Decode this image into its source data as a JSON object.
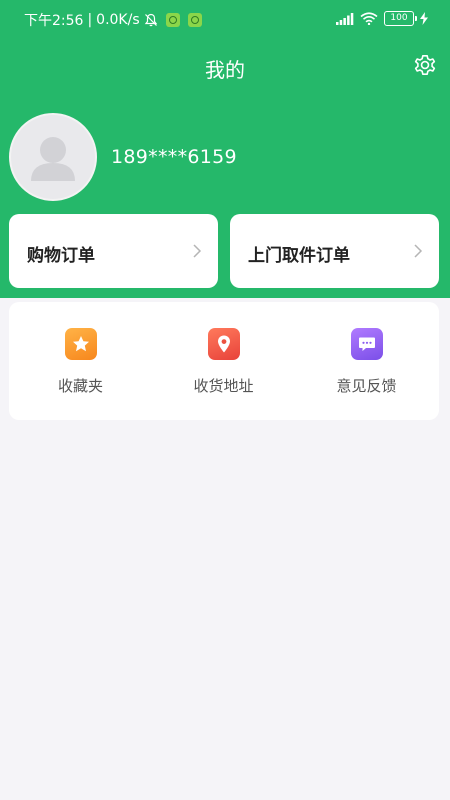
{
  "status_bar": {
    "time": "下午2:56",
    "network_speed": "0.0K/s",
    "battery": "100"
  },
  "header": {
    "title": "我的"
  },
  "profile": {
    "username": "189****6159"
  },
  "orders": [
    {
      "label": "购物订单"
    },
    {
      "label": "上门取件订单"
    }
  ],
  "menu": [
    {
      "label": "收藏夹",
      "icon": "star-icon",
      "color": "#f7941d"
    },
    {
      "label": "收货地址",
      "icon": "location-pin-icon",
      "color": "#f0543f"
    },
    {
      "label": "意见反馈",
      "icon": "chat-bubble-icon",
      "color": "#8a5cf0"
    }
  ],
  "colors": {
    "primary": "#25b86a",
    "background": "#f5f4f8"
  }
}
